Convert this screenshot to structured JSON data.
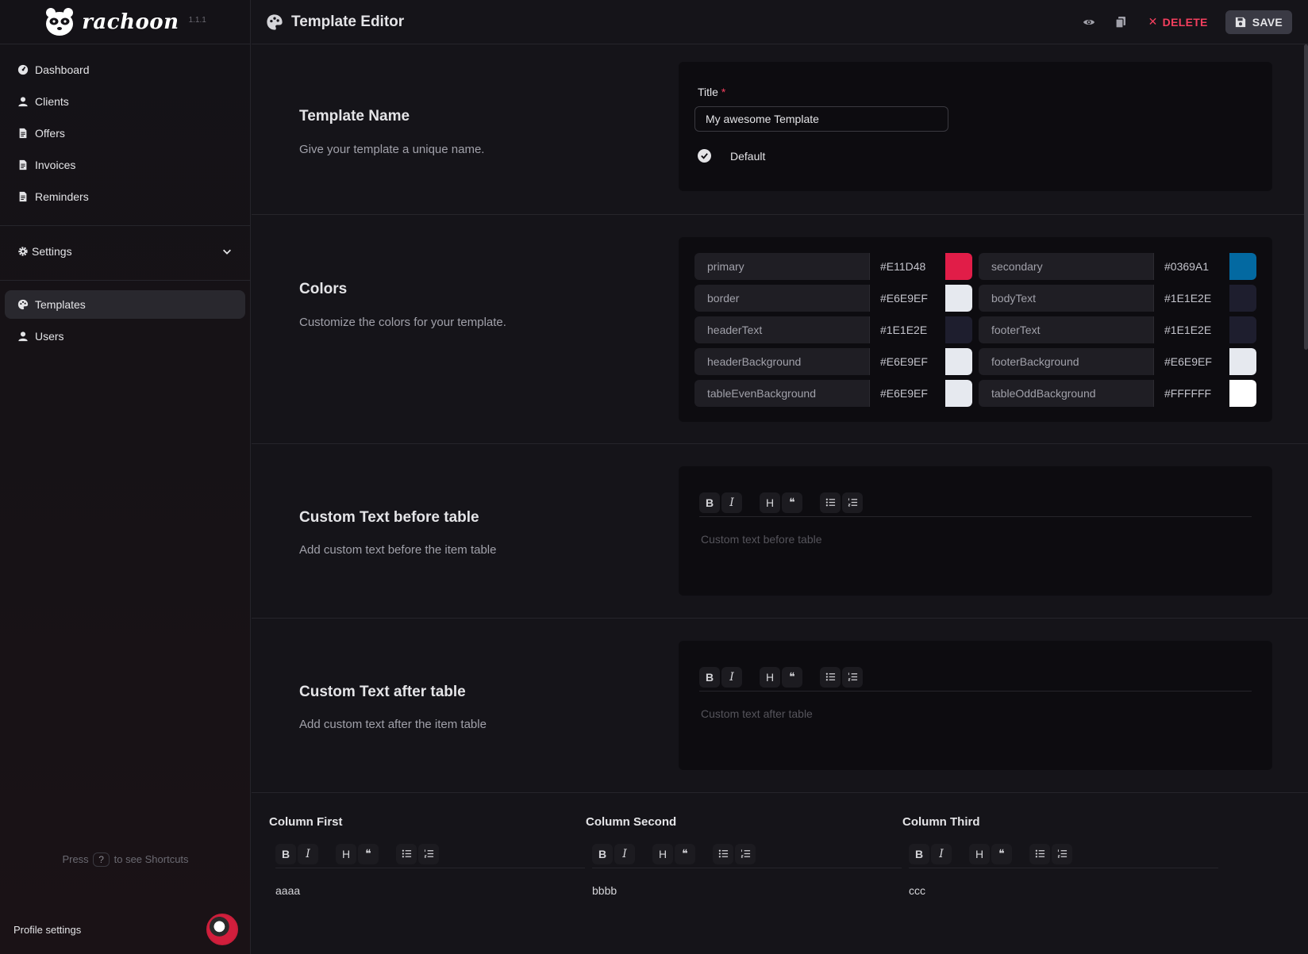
{
  "app": {
    "name": "rachoon",
    "version": "1.1.1"
  },
  "sidebar": {
    "main_items": [
      {
        "label": "Dashboard",
        "icon": "dashboard-icon"
      },
      {
        "label": "Clients",
        "icon": "user-icon"
      },
      {
        "label": "Offers",
        "icon": "document-icon"
      },
      {
        "label": "Invoices",
        "icon": "document-icon"
      },
      {
        "label": "Reminders",
        "icon": "document-icon"
      }
    ],
    "settings_label": "Settings",
    "settings_items": [
      {
        "label": "Templates",
        "icon": "palette-icon",
        "active": true
      },
      {
        "label": "Users",
        "icon": "user-icon"
      }
    ],
    "hint_pre": "Press",
    "hint_key": "?",
    "hint_post": "to see Shortcuts",
    "profile_label": "Profile settings"
  },
  "header": {
    "title": "Template Editor",
    "delete_label": "DELETE",
    "save_label": "SAVE"
  },
  "template_name": {
    "title": "Template Name",
    "description": "Give your template a unique name.",
    "field_label": "Title",
    "required_mark": "*",
    "value": "My awesome Template",
    "default_label": "Default"
  },
  "colors": {
    "title": "Colors",
    "description": "Customize the colors for your template.",
    "items": [
      {
        "name": "primary",
        "hex": "#E11D48",
        "swatch": "#E11D48"
      },
      {
        "name": "secondary",
        "hex": "#0369A1",
        "swatch": "#0369A1"
      },
      {
        "name": "border",
        "hex": "#E6E9EF",
        "swatch": "#E6E9EF"
      },
      {
        "name": "bodyText",
        "hex": "#1E1E2E",
        "swatch": "#1E1E2E"
      },
      {
        "name": "headerText",
        "hex": "#1E1E2E",
        "swatch": "#1E1E2E"
      },
      {
        "name": "footerText",
        "hex": "#1E1E2E",
        "swatch": "#1E1E2E"
      },
      {
        "name": "headerBackground",
        "hex": "#E6E9EF",
        "swatch": "#E6E9EF"
      },
      {
        "name": "footerBackground",
        "hex": "#E6E9EF",
        "swatch": "#E6E9EF"
      },
      {
        "name": "tableEvenBackground",
        "hex": "#E6E9EF",
        "swatch": "#E6E9EF"
      },
      {
        "name": "tableOddBackground",
        "hex": "#FFFFFF",
        "swatch": "#FFFFFF"
      }
    ]
  },
  "text_before": {
    "title": "Custom Text before table",
    "description": "Add custom text before the item table",
    "placeholder": "Custom text before table"
  },
  "text_after": {
    "title": "Custom Text after table",
    "description": "Add custom text after the item table",
    "placeholder": "Custom text after table"
  },
  "toolbar": {
    "bold": "B",
    "italic": "I",
    "heading": "H",
    "quote": "❝"
  },
  "columns": [
    {
      "title": "Column First",
      "content": "aaaa"
    },
    {
      "title": "Column Second",
      "content": "bbbb"
    },
    {
      "title": "Column Third",
      "content": "ccc"
    }
  ]
}
